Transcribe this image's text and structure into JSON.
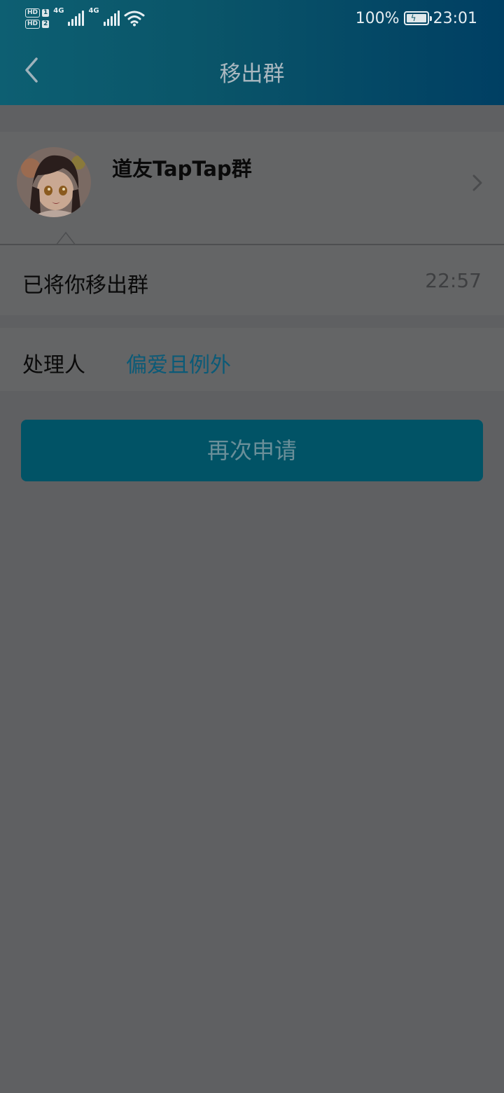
{
  "status_bar": {
    "hd1_label": "HD",
    "hd1_sim": "1",
    "hd2_label": "HD",
    "hd2_sim": "2",
    "net1": "4G",
    "net2": "4G",
    "battery_percent": "100%",
    "time": "23:01"
  },
  "nav": {
    "title": "移出群",
    "back_icon": "chevron-left-icon"
  },
  "group": {
    "name": "道友TapTap群",
    "avatar": "anime-girl-avatar"
  },
  "message": {
    "text": "已将你移出群",
    "time": "22:57"
  },
  "handler": {
    "label": "处理人",
    "name": "偏爱且例外"
  },
  "actions": {
    "reapply_label": "再次申请"
  },
  "colors": {
    "header_start": "#0d5f72",
    "header_end": "#003f63",
    "accent_button": "#015366",
    "link": "#0b5a77",
    "overlay_bg": "#5f6062"
  }
}
